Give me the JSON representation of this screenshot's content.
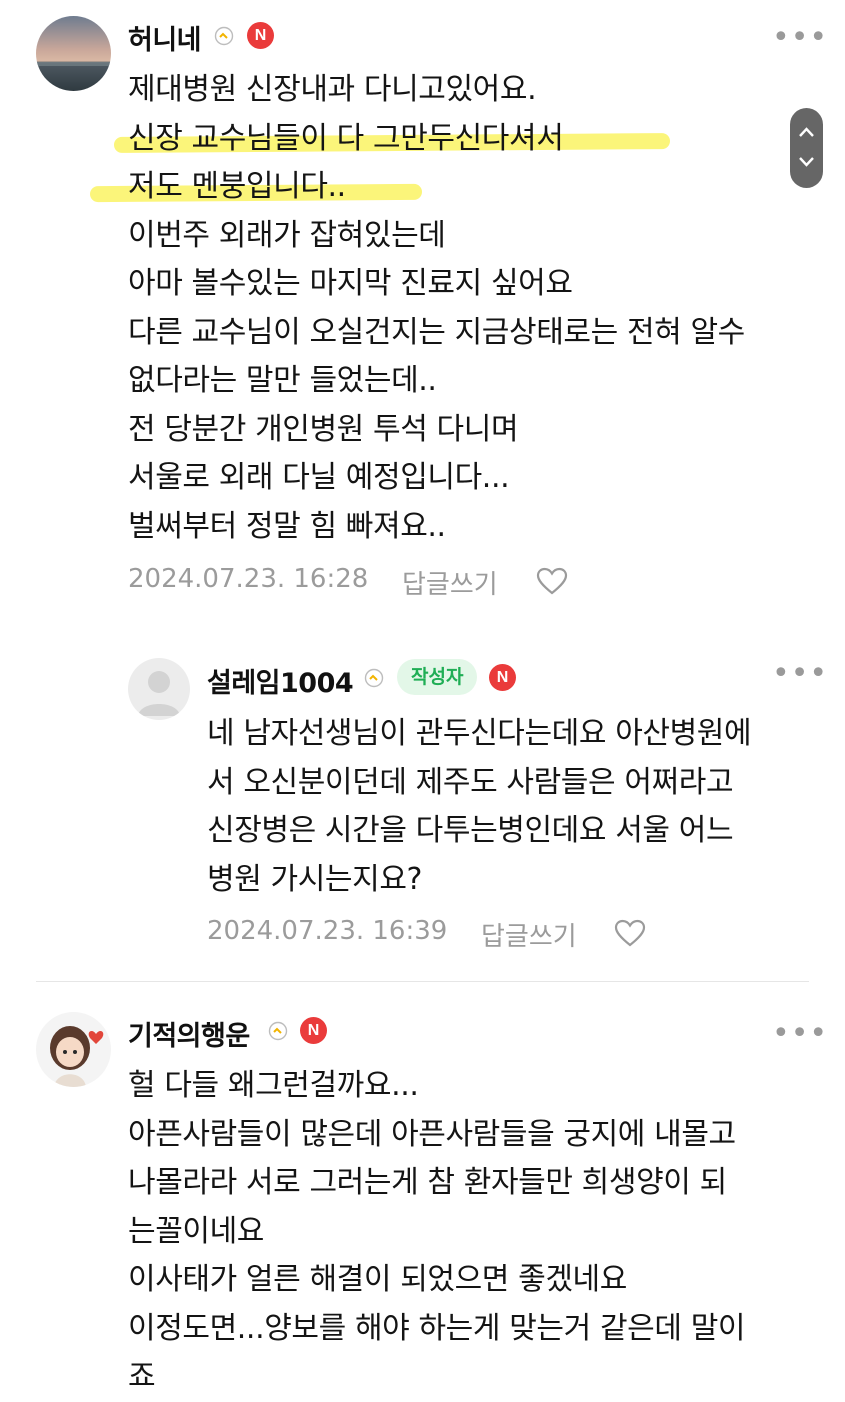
{
  "comments": [
    {
      "author": "허니네",
      "n_badge": "N",
      "lines": [
        "제대병원 신장내과 다니고있어요.",
        "신장 교수님들이 다 그만두신다셔서",
        "저도 멘붕입니다..",
        "이번주 외래가 잡혀있는데",
        "아마 볼수있는 마지막 진료지 싶어요",
        "다른 교수님이 오실건지는 지금상태로는 전혀 알수",
        "없다라는 말만 들었는데..",
        "전 당분간 개인병원 투석 다니며",
        "서울로 외래 다닐 예정입니다...",
        "벌써부터 정말 힘 빠져요.."
      ],
      "timestamp": "2024.07.23. 16:28",
      "reply_label": "답글쓰기"
    },
    {
      "author": "설레임1004",
      "author_tag": "작성자",
      "n_badge": "N",
      "lines": [
        "네 남자선생님이 관두신다는데요 아산병원에",
        "서 오신분이던데 제주도 사람들은 어쩌라고",
        "신장병은 시간을 다투는병인데요 서울 어느",
        "병원 가시는지요?"
      ],
      "timestamp": "2024.07.23. 16:39",
      "reply_label": "답글쓰기"
    },
    {
      "author": "기적의행운",
      "n_badge": "N",
      "lines": [
        "헐 다들 왜그런걸까요...",
        "아픈사람들이 많은데 아픈사람들을 궁지에 내몰고",
        "나몰라라 서로 그러는게 참 환자들만 희생양이 되",
        "는꼴이네요",
        "이사태가 얼른 해결이 되었으면 좋겠네요",
        "이정도면...양보를 해야 하는게 맞는거 같은데 말이",
        "죠"
      ]
    }
  ],
  "more_label": "•••",
  "colors": {
    "highlight": "#fbf57a",
    "badge": "#ea3b3b",
    "author_tag_bg": "#e3f7e8",
    "author_tag_fg": "#1fae55"
  }
}
